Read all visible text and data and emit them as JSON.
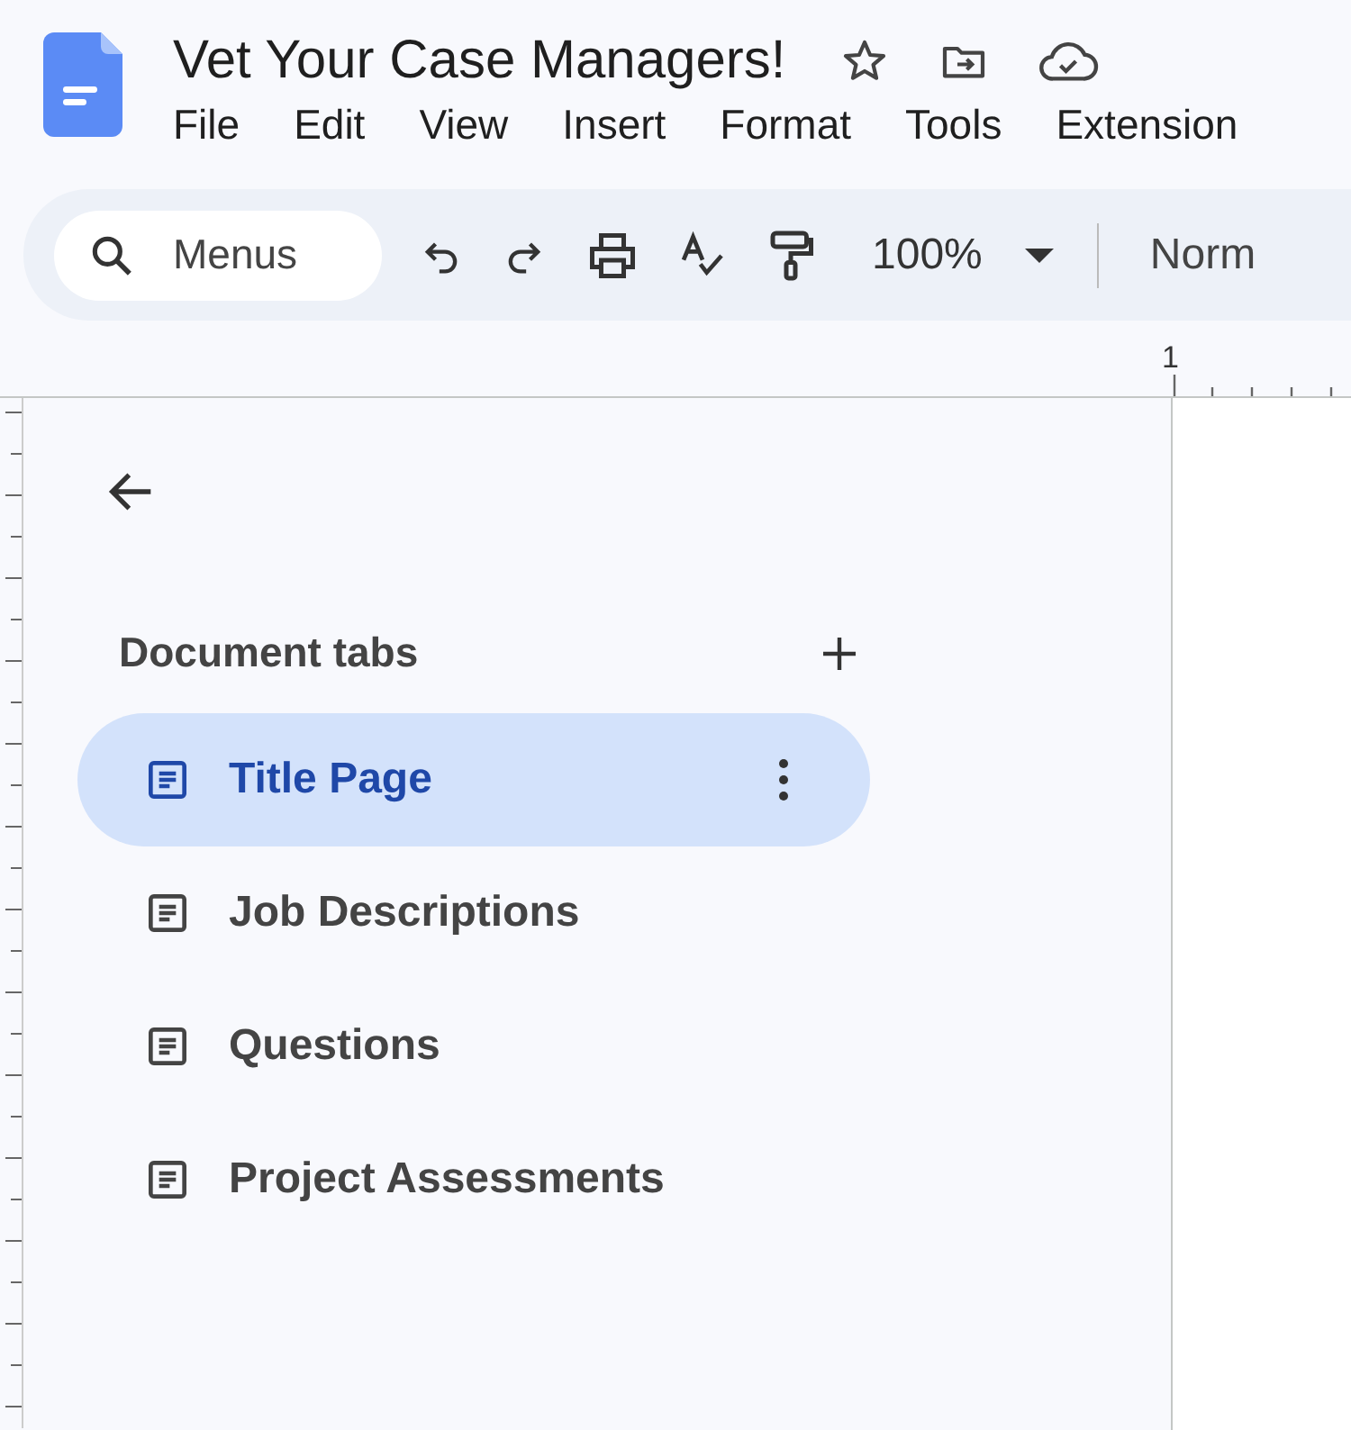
{
  "document": {
    "title": "Vet Your Case Managers!"
  },
  "menu_bar": [
    "File",
    "Edit",
    "View",
    "Insert",
    "Format",
    "Tools",
    "Extension"
  ],
  "toolbar": {
    "search": {
      "placeholder": "Menus"
    },
    "zoom": "100%",
    "style": "Norm"
  },
  "ruler": {
    "mark": "1"
  },
  "sidebar": {
    "heading": "Document tabs",
    "tabs": [
      {
        "label": "Title Page",
        "selected": true
      },
      {
        "label": "Job Descriptions",
        "selected": false
      },
      {
        "label": "Questions",
        "selected": false
      },
      {
        "label": "Project Assessments",
        "selected": false
      }
    ]
  }
}
